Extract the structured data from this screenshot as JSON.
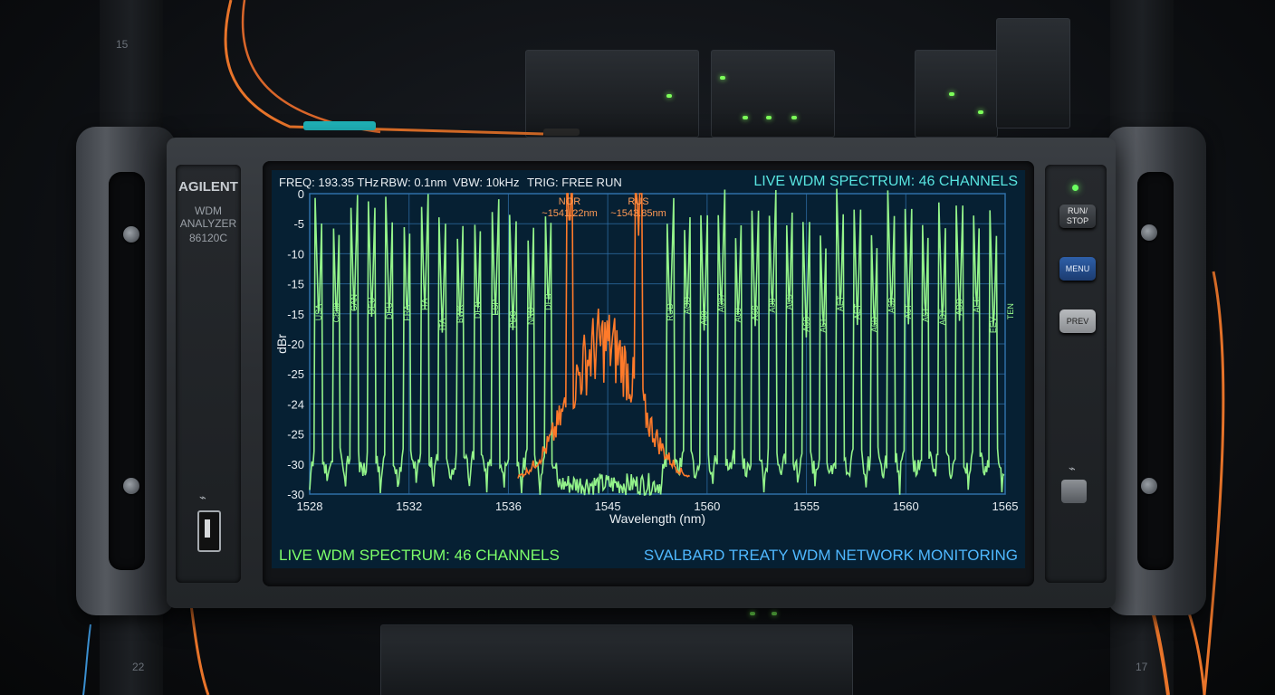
{
  "rack": {
    "unit_numbers": [
      "15",
      "22",
      "17"
    ]
  },
  "instrument": {
    "brand": "AGILENT",
    "model_line1": "WDM",
    "model_line2": "ANALYZER",
    "model_number": "86120C",
    "usb_symbol": "⭍"
  },
  "buttons": {
    "run_stop": "RUN/ STOP",
    "menu": "MENU",
    "prev": "PREV"
  },
  "screen": {
    "freq": "FREQ: 193.35 THz",
    "rbw": "RBW: 0.1nm",
    "vbw": "VBW: 10kHz",
    "trig": "TRIG: FREE RUN",
    "title_top": "LIVE WDM SPECTRUM: 46 CHANNELS",
    "title_bottom_left": "LIVE WDM SPECTRUM: 46 CHANNELS",
    "title_bottom_right": "SVALBARD TREATY WDM NETWORK MONITORING"
  },
  "chart_data": {
    "type": "line",
    "xlabel": "Wavelength (nm)",
    "ylabel": "dBr",
    "x_tick_labels": [
      "1528",
      "1532",
      "1536",
      "1545",
      "1560",
      "1555",
      "1560",
      "1565"
    ],
    "y_tick_labels": [
      "0",
      "-5",
      "-10",
      "-15",
      "-15",
      "-20",
      "-25",
      "-24",
      "-25",
      "-30",
      "-30"
    ],
    "grid": true,
    "noise_floor_dbr": -29,
    "highlighted_channels": [
      {
        "code": "NOR",
        "wavelength_label": "~1541.22nm",
        "peak_dbr": -5
      },
      {
        "code": "RUS",
        "wavelength_label": "~1543.85nm",
        "peak_dbr": -5
      }
    ],
    "channel_labels_left": [
      "USA",
      "C880",
      "CAN",
      "DEU",
      "DEU",
      "FRA",
      "ITA",
      "ITA",
      "BWK",
      "DEN",
      "ESP",
      "PDC",
      "NNO",
      "DEB"
    ],
    "channel_labels_right": [
      "RUD",
      "AOD",
      "A00",
      "A087",
      "A08",
      "A6S",
      "A08",
      "A6S",
      "A6S",
      "A6T",
      "AET",
      "AET",
      "A6D",
      "A6D",
      "A6T",
      "A6T",
      "ADT",
      "ADD",
      "AEE",
      "EEV",
      "TEN"
    ],
    "colors": {
      "channels": "#9bff8f",
      "highlight": "#ff7a2a",
      "grid": "#2f6fa8",
      "screen_bg": "#062033"
    }
  }
}
